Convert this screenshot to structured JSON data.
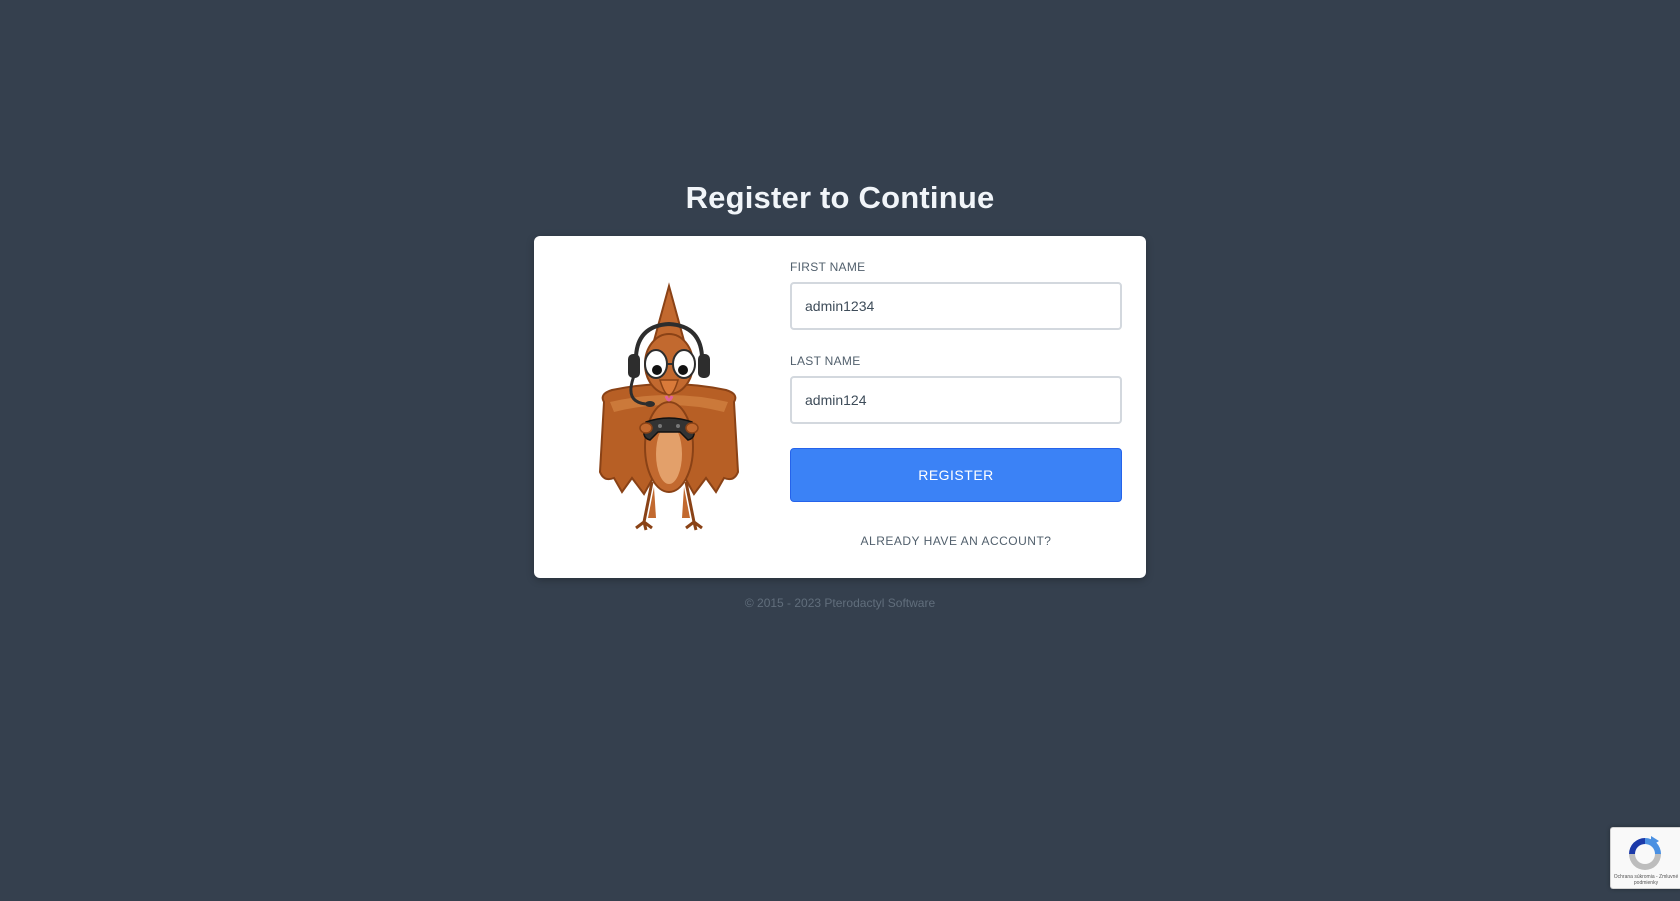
{
  "page": {
    "title": "Register to Continue"
  },
  "form": {
    "first_name": {
      "label": "FIRST NAME",
      "value": "admin1234"
    },
    "last_name": {
      "label": "LAST NAME",
      "value": "admin124"
    },
    "submit_label": "REGISTER",
    "login_link": "ALREADY HAVE AN ACCOUNT?"
  },
  "footer": {
    "copyright": "© 2015 - 2023 Pterodactyl Software"
  },
  "recaptcha": {
    "icon": "recaptcha-icon",
    "text": "Ochrana súkromia - Zmluvné podmienky"
  },
  "colors": {
    "background": "#35404e",
    "card": "#ffffff",
    "primary_button": "#3b82f6",
    "mascot": "#c2692f"
  }
}
